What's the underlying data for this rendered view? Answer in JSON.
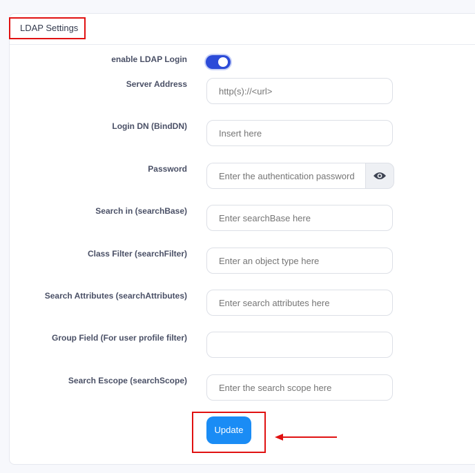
{
  "section": {
    "title": "LDAP Settings"
  },
  "fields": {
    "enable_login": {
      "label": "enable LDAP Login",
      "enabled": true
    },
    "server_address": {
      "label": "Server Address",
      "placeholder": "http(s)://<url>"
    },
    "login_dn": {
      "label": "Login DN (BindDN)",
      "placeholder": "Insert here"
    },
    "password": {
      "label": "Password",
      "placeholder": "Enter the authentication password"
    },
    "search_in": {
      "label": "Search in (searchBase)",
      "placeholder": "Enter searchBase here"
    },
    "class_filter": {
      "label": "Class Filter (searchFilter)",
      "placeholder": "Enter an object type here"
    },
    "search_attributes": {
      "label": "Search Attributes (searchAttributes)",
      "placeholder": "Enter search attributes here"
    },
    "group_field": {
      "label": "Group Field (For user profile filter)",
      "placeholder": ""
    },
    "search_scope": {
      "label": "Search Escope (searchScope)",
      "placeholder": "Enter the search scope here"
    }
  },
  "actions": {
    "update_label": "Update"
  },
  "colors": {
    "toggle_on": "#2c4bd8",
    "primary_button": "#1a8cf5",
    "highlight": "#e01010"
  },
  "icons": {
    "password_toggle": "eye-icon"
  }
}
